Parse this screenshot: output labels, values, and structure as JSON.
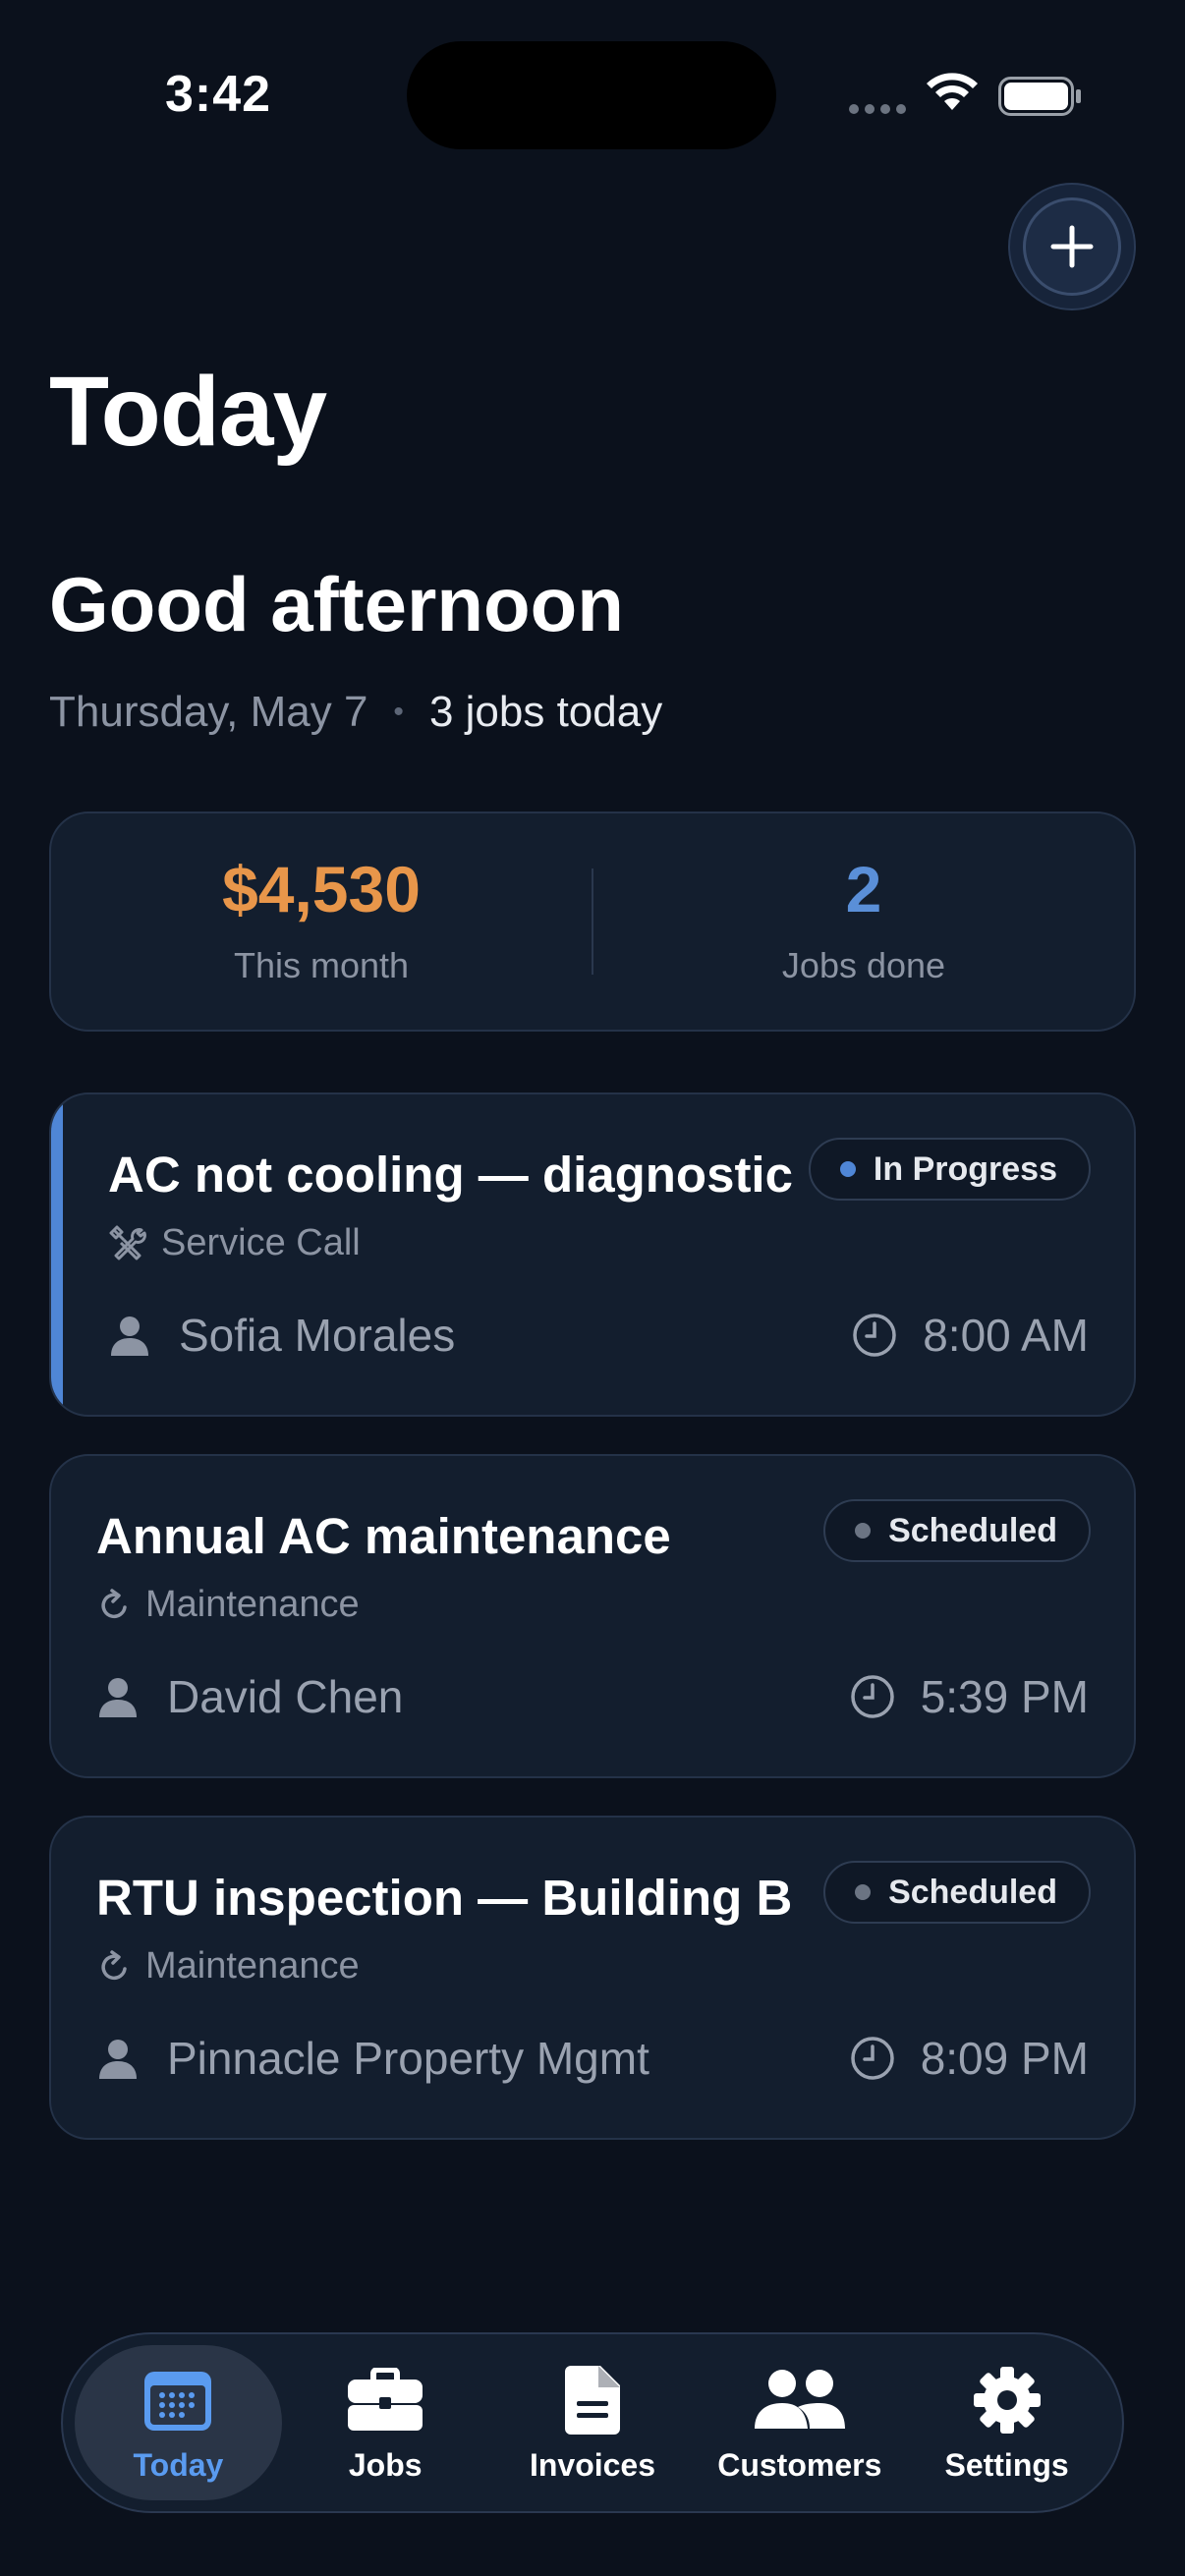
{
  "status_bar": {
    "time": "3:42"
  },
  "header": {
    "title": "Today",
    "greeting": "Good afternoon",
    "date": "Thursday, May 7",
    "jobs_count": "3 jobs today"
  },
  "stats": {
    "revenue_value": "$4,530",
    "revenue_label": "This month",
    "jobs_done_value": "2",
    "jobs_done_label": "Jobs done"
  },
  "jobs": [
    {
      "title": "AC not cooling — diagnostic",
      "type": "Service Call",
      "type_icon": "tools-icon",
      "customer": "Sofia Morales",
      "time": "8:00 AM",
      "status": "In Progress",
      "status_color": "#4f86d6"
    },
    {
      "title": "Annual AC maintenance",
      "type": "Maintenance",
      "type_icon": "refresh-icon",
      "customer": "David Chen",
      "time": "5:39 PM",
      "status": "Scheduled",
      "status_color": "#6b7483"
    },
    {
      "title": "RTU inspection — Building B",
      "type": "Maintenance",
      "type_icon": "refresh-icon",
      "customer": "Pinnacle Property Mgmt",
      "time": "8:09 PM",
      "status": "Scheduled",
      "status_color": "#6b7483"
    }
  ],
  "tabs": [
    {
      "label": "Today",
      "icon": "calendar-icon",
      "selected": true
    },
    {
      "label": "Jobs",
      "icon": "briefcase-icon",
      "selected": false
    },
    {
      "label": "Invoices",
      "icon": "document-icon",
      "selected": false
    },
    {
      "label": "Customers",
      "icon": "people-icon",
      "selected": false
    },
    {
      "label": "Settings",
      "icon": "gear-icon",
      "selected": false
    }
  ],
  "colors": {
    "background": "#0b111c",
    "card": "#131e2e",
    "accent": "#4f86d6",
    "revenue": "#e8964a",
    "jobs_done": "#5a8fd8",
    "tab_selected": "#5a9bf0"
  }
}
